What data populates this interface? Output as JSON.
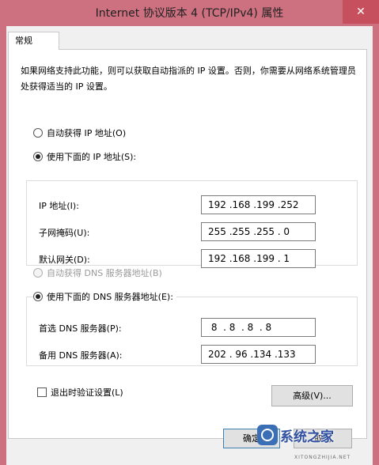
{
  "window": {
    "title": "Internet 协议版本 4 (TCP/IPv4) 属性",
    "close_glyph": "✕"
  },
  "tabs": {
    "general": "常规"
  },
  "description": "如果网络支持此功能，则可以获取自动指派的 IP 设置。否则，你需要从网络系统管理员处获得适当的 IP 设置。",
  "ip": {
    "auto_label": "自动获得 IP 地址(O)",
    "manual_label": "使用下面的 IP 地址(S):",
    "mode": "manual",
    "address_label": "IP 地址(I):",
    "address_value": "192 .168 .199 .252",
    "mask_label": "子网掩码(U):",
    "mask_value": "255 .255 .255 . 0",
    "gateway_label": "默认网关(D):",
    "gateway_value": "192 .168 .199 . 1"
  },
  "dns": {
    "auto_label": "自动获得 DNS 服务器地址(B)",
    "auto_disabled": true,
    "manual_label": "使用下面的 DNS 服务器地址(E):",
    "mode": "manual",
    "preferred_label": "首选 DNS 服务器(P):",
    "preferred_value": " 8  . 8  . 8  . 8",
    "alternate_label": "备用 DNS 服务器(A):",
    "alternate_value": "202 . 96 .134 .133"
  },
  "validate_on_exit": {
    "label": "退出时验证设置(L)",
    "checked": false
  },
  "buttons": {
    "advanced": "高级(V)...",
    "ok": "确定",
    "cancel": "取消"
  },
  "watermark": {
    "text": "系统之家",
    "sub": "XITONGZHIJIA.NET",
    "logo": "windows-logo-icon"
  },
  "colors": {
    "frame": "#cd7080",
    "close_button": "#c7505e",
    "watermark": "#2f4fa0"
  }
}
